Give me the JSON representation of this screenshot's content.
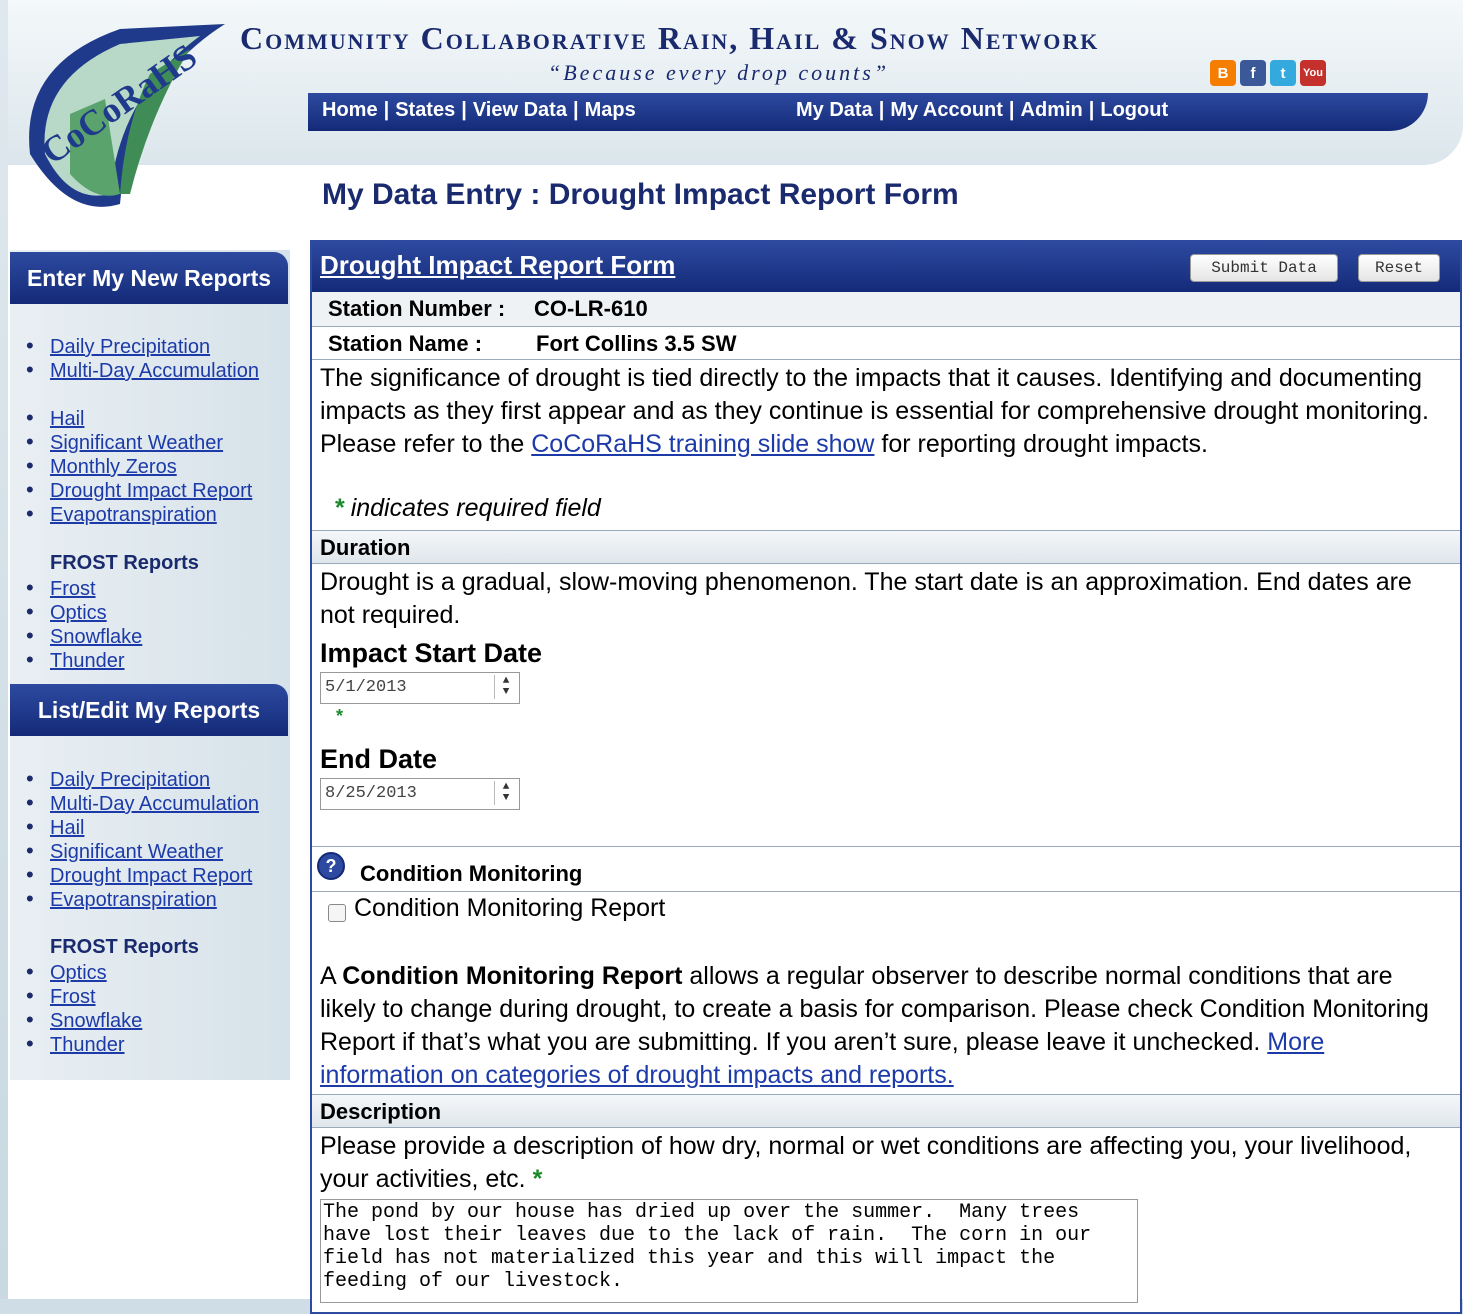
{
  "header": {
    "site_title": "Community Collaborative Rain, Hail & Snow Network",
    "tagline": "“Because every drop counts”",
    "logo_text": "CoCoRaHS",
    "social_icons": [
      "blogger-icon",
      "facebook-icon",
      "twitter-icon",
      "youtube-icon"
    ]
  },
  "nav": {
    "left": [
      "Home",
      "States",
      "View Data",
      "Maps"
    ],
    "right": [
      "My Data",
      "My Account",
      "Admin",
      "Logout"
    ]
  },
  "page_title": "My Data Entry : Drought Impact Report Form",
  "sidebar": {
    "enter_heading": "Enter My New Reports",
    "enter_group1": [
      "Daily Precipitation",
      "Multi-Day Accumulation"
    ],
    "enter_group2": [
      "Hail",
      "Significant Weather",
      "Monthly Zeros",
      "Drought Impact Report",
      "Evapotranspiration"
    ],
    "frost_heading": "FROST Reports",
    "enter_frost": [
      "Frost",
      "Optics",
      "Snowflake",
      "Thunder"
    ],
    "list_heading": "List/Edit My Reports",
    "list_group": [
      "Daily Precipitation",
      "Multi-Day Accumulation",
      "Hail",
      "Significant Weather",
      "Drought Impact Report",
      "Evapotranspiration"
    ],
    "list_frost": [
      "Optics",
      "Frost",
      "Snowflake",
      "Thunder"
    ]
  },
  "form": {
    "title": "Drought Impact Report Form",
    "submit_label": "Submit Data",
    "reset_label": "Reset",
    "station_number_label": "Station Number :",
    "station_number": "CO-LR-610",
    "station_name_label": "Station Name :",
    "station_name": "Fort Collins 3.5 SW",
    "intro_before_link": "The significance of drought is tied directly to the impacts that it causes. Identifying and documenting impacts as they first appear and as they continue is essential for comprehensive drought monitoring. Please refer to the ",
    "intro_link": "CoCoRaHS training slide show",
    "intro_after_link": " for reporting drought impacts.",
    "required_note": "indicates required field",
    "duration_heading": "Duration",
    "duration_text": "Drought is a gradual, slow-moving phenomenon. The start date is an approximation. End dates are not required.",
    "start_date_label": "Impact Start Date",
    "start_date": "5/1/2013",
    "end_date_label": "End Date",
    "end_date": "8/25/2013",
    "condition_heading": "Condition Monitoring",
    "condition_checkbox_label": "Condition Monitoring Report",
    "condition_checked": false,
    "condition_text_a": "A ",
    "condition_text_bold": "Condition Monitoring Report",
    "condition_text_b": " allows a regular observer to describe normal conditions that are likely to change during drought, to create a basis for comparison. Please check Condition Monitoring Report if that’s what you are submitting. If you aren’t sure, please leave it unchecked. ",
    "condition_link": "More information on categories of drought impacts and reports.",
    "description_heading": "Description",
    "description_prompt": "Please provide a description of how dry, normal or wet conditions are affecting you, your livelihood, your activities, etc.",
    "description_value": "The pond by our house has dried up over the summer.  Many trees have lost their leaves due to the lack of rain.  The corn in our field has not materialized this year and this will impact the feeding of our livestock."
  },
  "colors": {
    "nav_blue": "#1a2a6e",
    "link_blue": "#1c3aa8",
    "required_green": "#1a8a2a"
  }
}
